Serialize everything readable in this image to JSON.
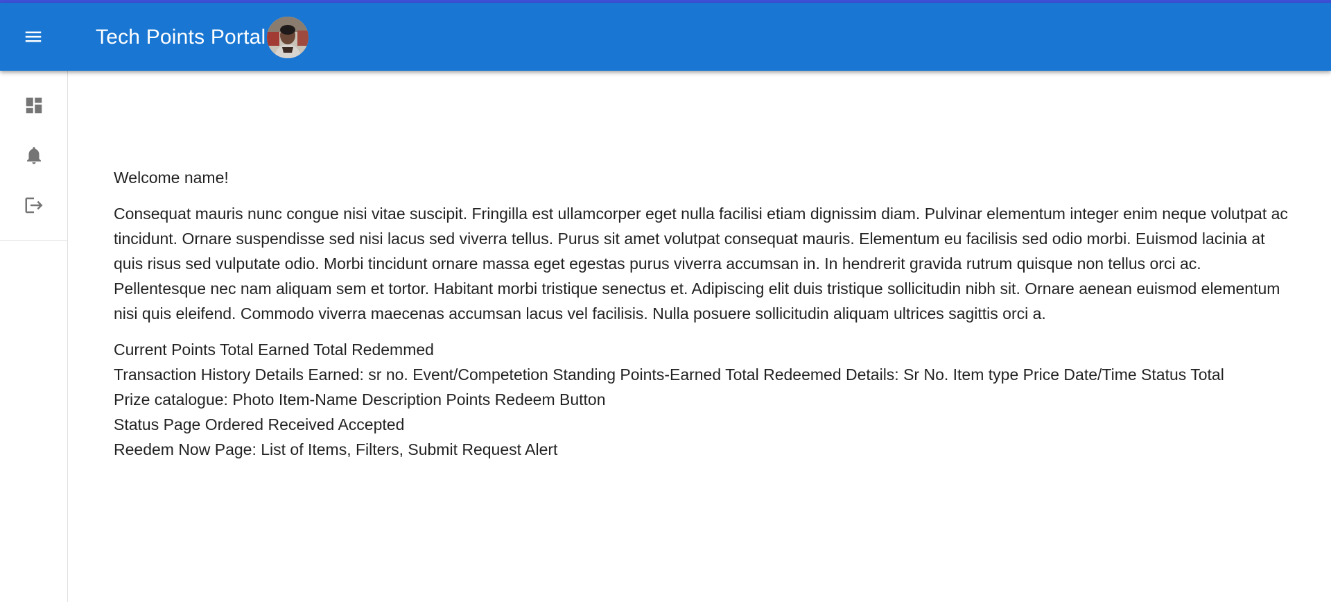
{
  "app": {
    "title": "Tech Points Portal"
  },
  "icons": {
    "menu": "menu-icon",
    "dashboard": "dashboard-icon",
    "notifications": "bell-icon",
    "logout": "logout-icon"
  },
  "colors": {
    "appbar": "#1976d2",
    "top_accent": "#3f51d9",
    "drawer_icon": "#757575"
  },
  "main": {
    "welcome": "Welcome name!",
    "paragraph": "Consequat mauris nunc congue nisi vitae suscipit. Fringilla est ullamcorper eget nulla facilisi etiam dignissim diam. Pulvinar elementum integer enim neque volutpat ac tincidunt. Ornare suspendisse sed nisi lacus sed viverra tellus. Purus sit amet volutpat consequat mauris. Elementum eu facilisis sed odio morbi. Euismod lacinia at quis risus sed vulputate odio. Morbi tincidunt ornare massa eget egestas purus viverra accumsan in. In hendrerit gravida rutrum quisque non tellus orci ac. Pellentesque nec nam aliquam sem et tortor. Habitant morbi tristique senectus et. Adipiscing elit duis tristique sollicitudin nibh sit. Ornare aenean euismod elementum nisi quis eleifend. Commodo viverra maecenas accumsan lacus vel facilisis. Nulla posuere sollicitudin aliquam ultrices sagittis orci a.",
    "notes": [
      "Current Points Total Earned Total Redemmed",
      "Transaction History Details Earned: sr no. Event/Competetion Standing Points-Earned Total Redeemed Details: Sr No. Item type Price Date/Time Status Total",
      "Prize catalogue: Photo Item-Name Description Points Redeem Button",
      "Status Page Ordered Received Accepted",
      "Reedem Now Page: List of Items, Filters, Submit Request Alert"
    ]
  }
}
